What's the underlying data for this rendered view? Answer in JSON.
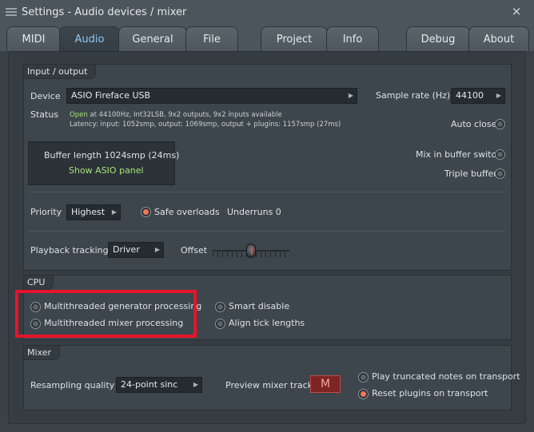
{
  "window": {
    "title": "Settings - Audio devices / mixer",
    "close_icon": "×"
  },
  "tabs": [
    {
      "label": "MIDI"
    },
    {
      "label": "Audio"
    },
    {
      "label": "General"
    },
    {
      "label": "File"
    },
    {
      "label": "Project"
    },
    {
      "label": "Info"
    },
    {
      "label": "Debug"
    },
    {
      "label": "About"
    }
  ],
  "active_tab": "Audio",
  "io": {
    "section_title": "Input / output",
    "device_label": "Device",
    "device_value": "ASIO Fireface USB",
    "sample_rate_label": "Sample rate (Hz)",
    "sample_rate_value": "44100",
    "status_label": "Status",
    "status_open": "Open",
    "status_line1_rest": " at 44100Hz, Int32LSB, 9x2 outputs, 9x2 inputs available",
    "status_line2": "Latency: input: 1052smp, output: 1069smp, output + plugins: 1157smp (27ms)",
    "auto_close_label": "Auto close",
    "buffer_length": "Buffer length 1024smp (24ms)",
    "show_asio_panel": "Show ASIO panel",
    "mix_in_buffer_switch_label": "Mix in buffer switch",
    "triple_buffer_label": "Triple buffer",
    "priority_label": "Priority",
    "priority_value": "Highest",
    "safe_overloads_label": "Safe overloads",
    "underruns_label": "Underruns 0",
    "playback_tracking_label": "Playback tracking",
    "playback_tracking_value": "Driver",
    "offset_label": "Offset",
    "offset_level": 0.5
  },
  "cpu": {
    "section_title": "CPU",
    "multithreaded_generator_label": "Multithreaded generator processing",
    "multithreaded_mixer_label": "Multithreaded mixer processing",
    "smart_disable_label": "Smart disable",
    "align_tick_lengths_label": "Align tick lengths"
  },
  "mixer": {
    "section_title": "Mixer",
    "resampling_quality_label": "Resampling quality",
    "resampling_quality_value": "24-point sinc",
    "preview_mixer_track_label": "Preview mixer track",
    "preview_mixer_track_value": "M",
    "play_truncated_notes_label": "Play truncated notes on transport",
    "reset_plugins_label": "Reset plugins on transport"
  },
  "colors": {
    "accent_tab": "#8cc8f4",
    "status_green": "#a6e07a",
    "radio_on": "#f07a5a",
    "highlight": "#e8132c"
  }
}
